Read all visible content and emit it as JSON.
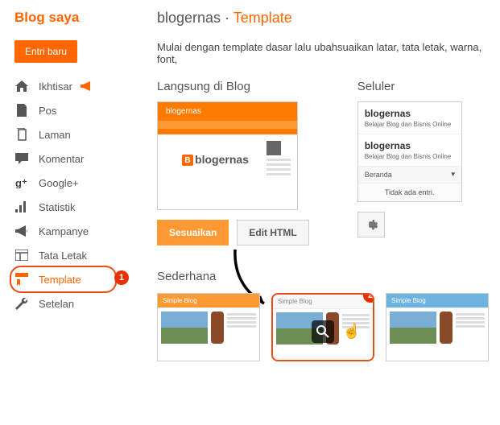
{
  "sidebar": {
    "title": "Blog saya",
    "new_entry": "Entri baru",
    "items": [
      {
        "label": "Ikhtisar"
      },
      {
        "label": "Pos"
      },
      {
        "label": "Laman"
      },
      {
        "label": "Komentar"
      },
      {
        "label": "Google+"
      },
      {
        "label": "Statistik"
      },
      {
        "label": "Kampanye"
      },
      {
        "label": "Tata Letak"
      },
      {
        "label": "Template"
      },
      {
        "label": "Setelan"
      }
    ]
  },
  "breadcrumb": {
    "blog": "blogernas",
    "sep": " · ",
    "page": "Template"
  },
  "desc": "Mulai dengan template dasar lalu ubahsuaikan latar, tata letak, warna, font,",
  "live": {
    "heading": "Langsung di Blog",
    "blog_title": "blogernas",
    "logo_text": "blogernas",
    "btn_customize": "Sesuaikan",
    "btn_edit": "Edit HTML"
  },
  "mobile": {
    "heading": "Seluler",
    "title1": "blogernas",
    "sub1": "Belajar Blog dan Bisnis Online",
    "title2": "blogernas",
    "sub2": "Belajar Blog dan Bisnis Online",
    "selector": "Beranda",
    "empty": "Tidak ada entri."
  },
  "simple": {
    "heading": "Sederhana",
    "thumb_label": "Simple Blog"
  },
  "annotations": {
    "step1": "1",
    "step2": "2"
  }
}
